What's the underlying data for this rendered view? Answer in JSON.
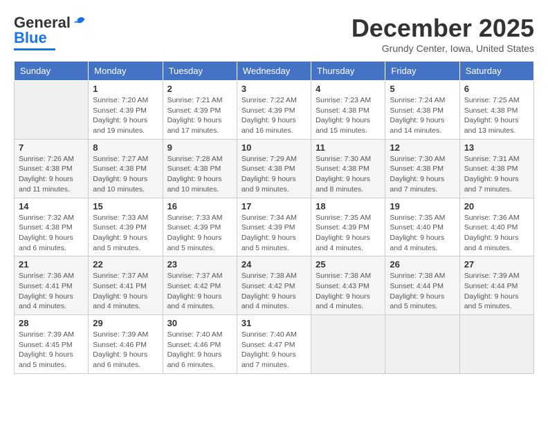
{
  "logo": {
    "line1": "General",
    "line2": "Blue",
    "tagline": ""
  },
  "header": {
    "month": "December 2025",
    "location": "Grundy Center, Iowa, United States"
  },
  "weekdays": [
    "Sunday",
    "Monday",
    "Tuesday",
    "Wednesday",
    "Thursday",
    "Friday",
    "Saturday"
  ],
  "weeks": [
    [
      {
        "day": "",
        "sunrise": "",
        "sunset": "",
        "daylight": ""
      },
      {
        "day": "1",
        "sunrise": "Sunrise: 7:20 AM",
        "sunset": "Sunset: 4:39 PM",
        "daylight": "Daylight: 9 hours and 19 minutes."
      },
      {
        "day": "2",
        "sunrise": "Sunrise: 7:21 AM",
        "sunset": "Sunset: 4:39 PM",
        "daylight": "Daylight: 9 hours and 17 minutes."
      },
      {
        "day": "3",
        "sunrise": "Sunrise: 7:22 AM",
        "sunset": "Sunset: 4:39 PM",
        "daylight": "Daylight: 9 hours and 16 minutes."
      },
      {
        "day": "4",
        "sunrise": "Sunrise: 7:23 AM",
        "sunset": "Sunset: 4:38 PM",
        "daylight": "Daylight: 9 hours and 15 minutes."
      },
      {
        "day": "5",
        "sunrise": "Sunrise: 7:24 AM",
        "sunset": "Sunset: 4:38 PM",
        "daylight": "Daylight: 9 hours and 14 minutes."
      },
      {
        "day": "6",
        "sunrise": "Sunrise: 7:25 AM",
        "sunset": "Sunset: 4:38 PM",
        "daylight": "Daylight: 9 hours and 13 minutes."
      }
    ],
    [
      {
        "day": "7",
        "sunrise": "Sunrise: 7:26 AM",
        "sunset": "Sunset: 4:38 PM",
        "daylight": "Daylight: 9 hours and 11 minutes."
      },
      {
        "day": "8",
        "sunrise": "Sunrise: 7:27 AM",
        "sunset": "Sunset: 4:38 PM",
        "daylight": "Daylight: 9 hours and 10 minutes."
      },
      {
        "day": "9",
        "sunrise": "Sunrise: 7:28 AM",
        "sunset": "Sunset: 4:38 PM",
        "daylight": "Daylight: 9 hours and 10 minutes."
      },
      {
        "day": "10",
        "sunrise": "Sunrise: 7:29 AM",
        "sunset": "Sunset: 4:38 PM",
        "daylight": "Daylight: 9 hours and 9 minutes."
      },
      {
        "day": "11",
        "sunrise": "Sunrise: 7:30 AM",
        "sunset": "Sunset: 4:38 PM",
        "daylight": "Daylight: 9 hours and 8 minutes."
      },
      {
        "day": "12",
        "sunrise": "Sunrise: 7:30 AM",
        "sunset": "Sunset: 4:38 PM",
        "daylight": "Daylight: 9 hours and 7 minutes."
      },
      {
        "day": "13",
        "sunrise": "Sunrise: 7:31 AM",
        "sunset": "Sunset: 4:38 PM",
        "daylight": "Daylight: 9 hours and 7 minutes."
      }
    ],
    [
      {
        "day": "14",
        "sunrise": "Sunrise: 7:32 AM",
        "sunset": "Sunset: 4:38 PM",
        "daylight": "Daylight: 9 hours and 6 minutes."
      },
      {
        "day": "15",
        "sunrise": "Sunrise: 7:33 AM",
        "sunset": "Sunset: 4:39 PM",
        "daylight": "Daylight: 9 hours and 5 minutes."
      },
      {
        "day": "16",
        "sunrise": "Sunrise: 7:33 AM",
        "sunset": "Sunset: 4:39 PM",
        "daylight": "Daylight: 9 hours and 5 minutes."
      },
      {
        "day": "17",
        "sunrise": "Sunrise: 7:34 AM",
        "sunset": "Sunset: 4:39 PM",
        "daylight": "Daylight: 9 hours and 5 minutes."
      },
      {
        "day": "18",
        "sunrise": "Sunrise: 7:35 AM",
        "sunset": "Sunset: 4:39 PM",
        "daylight": "Daylight: 9 hours and 4 minutes."
      },
      {
        "day": "19",
        "sunrise": "Sunrise: 7:35 AM",
        "sunset": "Sunset: 4:40 PM",
        "daylight": "Daylight: 9 hours and 4 minutes."
      },
      {
        "day": "20",
        "sunrise": "Sunrise: 7:36 AM",
        "sunset": "Sunset: 4:40 PM",
        "daylight": "Daylight: 9 hours and 4 minutes."
      }
    ],
    [
      {
        "day": "21",
        "sunrise": "Sunrise: 7:36 AM",
        "sunset": "Sunset: 4:41 PM",
        "daylight": "Daylight: 9 hours and 4 minutes."
      },
      {
        "day": "22",
        "sunrise": "Sunrise: 7:37 AM",
        "sunset": "Sunset: 4:41 PM",
        "daylight": "Daylight: 9 hours and 4 minutes."
      },
      {
        "day": "23",
        "sunrise": "Sunrise: 7:37 AM",
        "sunset": "Sunset: 4:42 PM",
        "daylight": "Daylight: 9 hours and 4 minutes."
      },
      {
        "day": "24",
        "sunrise": "Sunrise: 7:38 AM",
        "sunset": "Sunset: 4:42 PM",
        "daylight": "Daylight: 9 hours and 4 minutes."
      },
      {
        "day": "25",
        "sunrise": "Sunrise: 7:38 AM",
        "sunset": "Sunset: 4:43 PM",
        "daylight": "Daylight: 9 hours and 4 minutes."
      },
      {
        "day": "26",
        "sunrise": "Sunrise: 7:38 AM",
        "sunset": "Sunset: 4:44 PM",
        "daylight": "Daylight: 9 hours and 5 minutes."
      },
      {
        "day": "27",
        "sunrise": "Sunrise: 7:39 AM",
        "sunset": "Sunset: 4:44 PM",
        "daylight": "Daylight: 9 hours and 5 minutes."
      }
    ],
    [
      {
        "day": "28",
        "sunrise": "Sunrise: 7:39 AM",
        "sunset": "Sunset: 4:45 PM",
        "daylight": "Daylight: 9 hours and 5 minutes."
      },
      {
        "day": "29",
        "sunrise": "Sunrise: 7:39 AM",
        "sunset": "Sunset: 4:46 PM",
        "daylight": "Daylight: 9 hours and 6 minutes."
      },
      {
        "day": "30",
        "sunrise": "Sunrise: 7:40 AM",
        "sunset": "Sunset: 4:46 PM",
        "daylight": "Daylight: 9 hours and 6 minutes."
      },
      {
        "day": "31",
        "sunrise": "Sunrise: 7:40 AM",
        "sunset": "Sunset: 4:47 PM",
        "daylight": "Daylight: 9 hours and 7 minutes."
      },
      {
        "day": "",
        "sunrise": "",
        "sunset": "",
        "daylight": ""
      },
      {
        "day": "",
        "sunrise": "",
        "sunset": "",
        "daylight": ""
      },
      {
        "day": "",
        "sunrise": "",
        "sunset": "",
        "daylight": ""
      }
    ]
  ]
}
